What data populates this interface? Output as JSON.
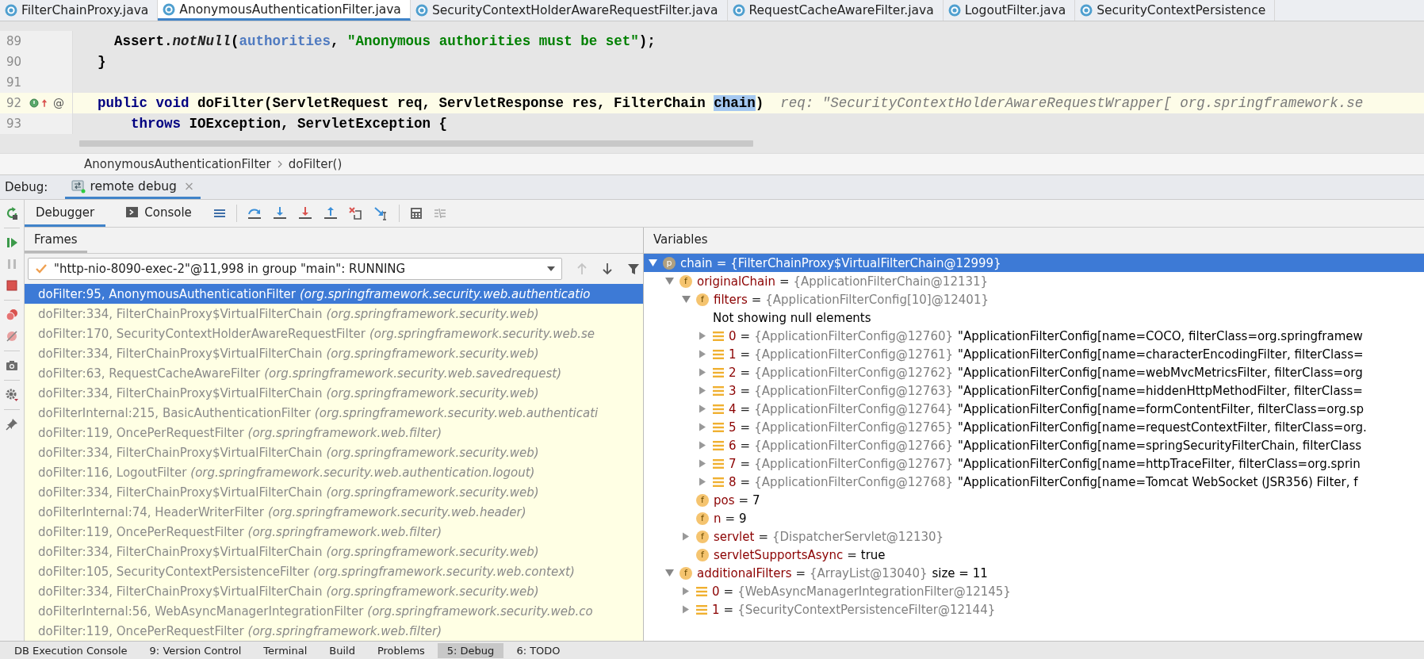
{
  "tabs": [
    {
      "label": "FilterChainProxy.java",
      "selected": false
    },
    {
      "label": "AnonymousAuthenticationFilter.java",
      "selected": true
    },
    {
      "label": "SecurityContextHolderAwareRequestFilter.java",
      "selected": false
    },
    {
      "label": "RequestCacheAwareFilter.java",
      "selected": false
    },
    {
      "label": "LogoutFilter.java",
      "selected": false
    },
    {
      "label": "SecurityContextPersistence",
      "selected": false
    }
  ],
  "editor": {
    "lines": [
      {
        "number": "89",
        "current": false,
        "tokens": [
          {
            "text": "    Assert.",
            "kind": "plain"
          },
          {
            "text": "notNull",
            "kind": "method"
          },
          {
            "text": "(",
            "kind": "plain"
          },
          {
            "text": "authorities",
            "kind": "field"
          },
          {
            "text": ", ",
            "kind": "plain"
          },
          {
            "text": "\"Anonymous authorities must be set\"",
            "kind": "string"
          },
          {
            "text": ");",
            "kind": "plain"
          }
        ]
      },
      {
        "number": "90",
        "current": false,
        "tokens": [
          {
            "text": "  }",
            "kind": "plain"
          }
        ]
      },
      {
        "number": "91",
        "current": false
      },
      {
        "number": "92",
        "current": true,
        "gutter": "@",
        "tokens": [
          {
            "text": "  public void ",
            "kind": "keyword"
          },
          {
            "text": "doFilter(ServletRequest req, ServletResponse res, FilterChain ",
            "kind": "plain"
          },
          {
            "text": "chain",
            "kind": "highlight"
          },
          {
            "text": ")",
            "kind": "plain"
          },
          {
            "text": "  req: \"SecurityContextHolderAwareRequestWrapper[ org.springframework.se",
            "kind": "hint"
          }
        ]
      },
      {
        "number": "93",
        "current": false,
        "tokens": [
          {
            "text": "      throws ",
            "kind": "keyword"
          },
          {
            "text": "IOException, ServletException {",
            "kind": "plain"
          }
        ]
      }
    ]
  },
  "breadcrumbs": [
    "AnonymousAuthenticationFilter",
    "doFilter()"
  ],
  "debug": {
    "label": "Debug:",
    "session": "remote debug",
    "close": "×"
  },
  "debug_tabs": [
    {
      "label": "Debugger",
      "kind": "debugger",
      "selected": true
    },
    {
      "label": "Console",
      "kind": "console",
      "selected": false
    }
  ],
  "frames": {
    "title": "Frames",
    "thread": "\"http-nio-8090-exec-2\"@11,998 in group \"main\": RUNNING",
    "items": [
      {
        "method": "doFilter:95, AnonymousAuthenticationFilter",
        "location": "(org.springframework.security.web.authenticatio",
        "selected": true
      },
      {
        "method": "doFilter:334, FilterChainProxy$VirtualFilterChain",
        "location": "(org.springframework.security.web)",
        "selected": false
      },
      {
        "method": "doFilter:170, SecurityContextHolderAwareRequestFilter",
        "location": "(org.springframework.security.web.se",
        "selected": false
      },
      {
        "method": "doFilter:334, FilterChainProxy$VirtualFilterChain",
        "location": "(org.springframework.security.web)",
        "selected": false
      },
      {
        "method": "doFilter:63, RequestCacheAwareFilter",
        "location": "(org.springframework.security.web.savedrequest)",
        "selected": false
      },
      {
        "method": "doFilter:334, FilterChainProxy$VirtualFilterChain",
        "location": "(org.springframework.security.web)",
        "selected": false
      },
      {
        "method": "doFilterInternal:215, BasicAuthenticationFilter",
        "location": "(org.springframework.security.web.authenticati",
        "selected": false
      },
      {
        "method": "doFilter:119, OncePerRequestFilter",
        "location": "(org.springframework.web.filter)",
        "selected": false
      },
      {
        "method": "doFilter:334, FilterChainProxy$VirtualFilterChain",
        "location": "(org.springframework.security.web)",
        "selected": false
      },
      {
        "method": "doFilter:116, LogoutFilter",
        "location": "(org.springframework.security.web.authentication.logout)",
        "selected": false
      },
      {
        "method": "doFilter:334, FilterChainProxy$VirtualFilterChain",
        "location": "(org.springframework.security.web)",
        "selected": false
      },
      {
        "method": "doFilterInternal:74, HeaderWriterFilter",
        "location": "(org.springframework.security.web.header)",
        "selected": false
      },
      {
        "method": "doFilter:119, OncePerRequestFilter",
        "location": "(org.springframework.web.filter)",
        "selected": false
      },
      {
        "method": "doFilter:334, FilterChainProxy$VirtualFilterChain",
        "location": "(org.springframework.security.web)",
        "selected": false
      },
      {
        "method": "doFilter:105, SecurityContextPersistenceFilter",
        "location": "(org.springframework.security.web.context)",
        "selected": false
      },
      {
        "method": "doFilter:334, FilterChainProxy$VirtualFilterChain",
        "location": "(org.springframework.security.web)",
        "selected": false
      },
      {
        "method": "doFilterInternal:56, WebAsyncManagerIntegrationFilter",
        "location": "(org.springframework.security.web.co",
        "selected": false
      },
      {
        "method": "doFilter:119, OncePerRequestFilter",
        "location": "(org.springframework.web.filter)",
        "selected": false
      }
    ]
  },
  "variables": {
    "title": "Variables",
    "items": [
      {
        "kind": "param",
        "badge": "p",
        "name": "chain",
        "eq": "=",
        "value": "{FilterChainProxy$VirtualFilterChain@12999}",
        "expanded": true,
        "selected": true,
        "children": [
          {
            "kind": "field",
            "badge": "f",
            "name": "originalChain",
            "eq": "=",
            "value": "{ApplicationFilterChain@12131}",
            "expanded": true,
            "selected": false,
            "children": [
              {
                "kind": "field",
                "badge": "f",
                "name": "filters",
                "eq": "=",
                "value": "{ApplicationFilterConfig[10]@12401}",
                "expanded": true,
                "selected": false,
                "children": [
                  {
                    "kind": "message",
                    "text": "Not showing null elements"
                  },
                  {
                    "kind": "element",
                    "name": "0",
                    "eq": "=",
                    "value": "{ApplicationFilterConfig@12760}",
                    "extra": "\"ApplicationFilterConfig[name=COCO, filterClass=org.springframew",
                    "expanded": false,
                    "selected": false
                  },
                  {
                    "kind": "element",
                    "name": "1",
                    "eq": "=",
                    "value": "{ApplicationFilterConfig@12761}",
                    "extra": "\"ApplicationFilterConfig[name=characterEncodingFilter, filterClass=",
                    "expanded": false,
                    "selected": false
                  },
                  {
                    "kind": "element",
                    "name": "2",
                    "eq": "=",
                    "value": "{ApplicationFilterConfig@12762}",
                    "extra": "\"ApplicationFilterConfig[name=webMvcMetricsFilter, filterClass=org",
                    "expanded": false,
                    "selected": false
                  },
                  {
                    "kind": "element",
                    "name": "3",
                    "eq": "=",
                    "value": "{ApplicationFilterConfig@12763}",
                    "extra": "\"ApplicationFilterConfig[name=hiddenHttpMethodFilter, filterClass=",
                    "expanded": false,
                    "selected": false
                  },
                  {
                    "kind": "element",
                    "name": "4",
                    "eq": "=",
                    "value": "{ApplicationFilterConfig@12764}",
                    "extra": "\"ApplicationFilterConfig[name=formContentFilter, filterClass=org.sp",
                    "expanded": false,
                    "selected": false
                  },
                  {
                    "kind": "element",
                    "name": "5",
                    "eq": "=",
                    "value": "{ApplicationFilterConfig@12765}",
                    "extra": "\"ApplicationFilterConfig[name=requestContextFilter, filterClass=org.",
                    "expanded": false,
                    "selected": false
                  },
                  {
                    "kind": "element",
                    "name": "6",
                    "eq": "=",
                    "value": "{ApplicationFilterConfig@12766}",
                    "extra": "\"ApplicationFilterConfig[name=springSecurityFilterChain, filterClass",
                    "expanded": false,
                    "selected": false
                  },
                  {
                    "kind": "element",
                    "name": "7",
                    "eq": "=",
                    "value": "{ApplicationFilterConfig@12767}",
                    "extra": "\"ApplicationFilterConfig[name=httpTraceFilter, filterClass=org.sprin",
                    "expanded": false,
                    "selected": false
                  },
                  {
                    "kind": "element",
                    "name": "8",
                    "eq": "=",
                    "value": "{ApplicationFilterConfig@12768}",
                    "extra": "\"ApplicationFilterConfig[name=Tomcat WebSocket (JSR356) Filter, f",
                    "expanded": false,
                    "selected": false
                  }
                ]
              },
              {
                "kind": "field",
                "badge": "f",
                "name": "pos",
                "eq": "=",
                "value": "7",
                "primitive": true,
                "selected": false
              },
              {
                "kind": "field",
                "badge": "f",
                "name": "n",
                "eq": "=",
                "value": "9",
                "primitive": true,
                "selected": false
              },
              {
                "kind": "field",
                "badge": "f",
                "name": "servlet",
                "eq": "=",
                "value": "{DispatcherServlet@12130}",
                "expanded": false,
                "selected": false
              },
              {
                "kind": "field",
                "badge": "f",
                "name": "servletSupportsAsync",
                "eq": "=",
                "value": "true",
                "primitive": true,
                "selected": false
              }
            ]
          },
          {
            "kind": "field",
            "badge": "f",
            "name": "additionalFilters",
            "eq": "=",
            "value": "{ArrayList@13040}",
            "extra": "size = 11",
            "expanded": true,
            "selected": false,
            "children": [
              {
                "kind": "element",
                "name": "0",
                "eq": "=",
                "value": "{WebAsyncManagerIntegrationFilter@12145}",
                "expanded": false,
                "selected": false
              },
              {
                "kind": "element",
                "name": "1",
                "eq": "=",
                "value": "{SecurityContextPersistenceFilter@12144}",
                "expanded": false,
                "selected": false
              }
            ]
          }
        ]
      }
    ]
  },
  "tool_windows": [
    {
      "label": "DB Execution Console",
      "selected": false
    },
    {
      "label": "9: Version Control",
      "selected": false
    },
    {
      "label": "Terminal",
      "selected": false
    },
    {
      "label": "Build",
      "selected": false
    },
    {
      "label": "Problems",
      "selected": false
    },
    {
      "label": "5: Debug",
      "selected": true
    },
    {
      "label": "6: TODO",
      "selected": false
    }
  ]
}
